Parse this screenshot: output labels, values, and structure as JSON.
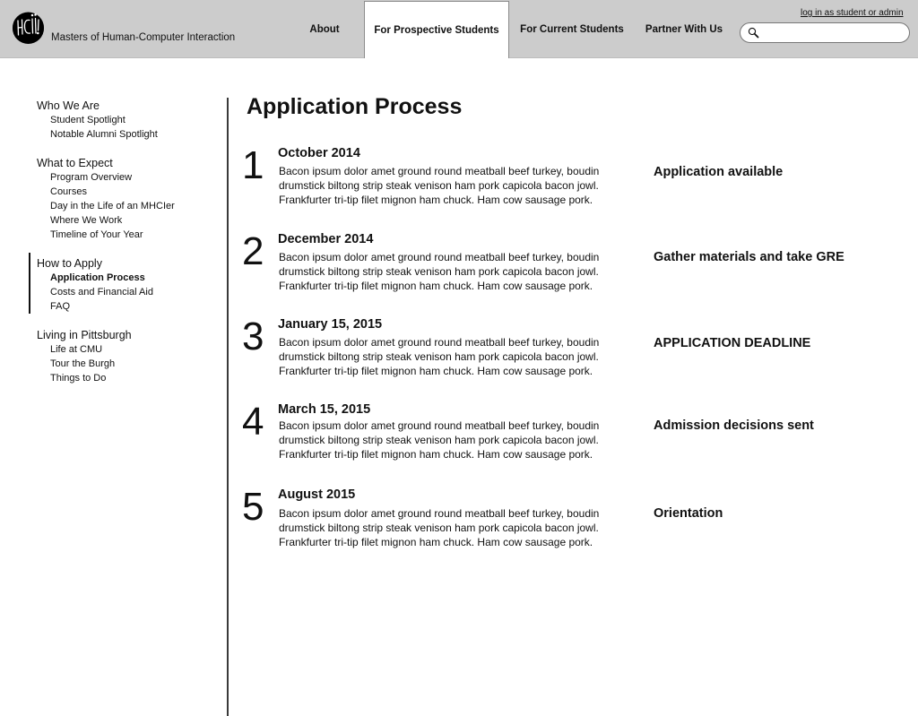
{
  "header": {
    "site_title": "Masters of Human-Computer Interaction",
    "logo_text": "HCII",
    "login_link": "log in as student or admin",
    "search": {
      "value": "",
      "placeholder": ""
    },
    "nav": [
      {
        "label": "About",
        "active": false
      },
      {
        "label": "For Prospective Students",
        "active": true
      },
      {
        "label": "For Current Students",
        "active": false
      },
      {
        "label": "Partner With Us",
        "active": false
      }
    ]
  },
  "sidebar": {
    "groups": [
      {
        "heading": "Who We Are",
        "links": [
          "Student Spotlight",
          "Notable Alumni Spotlight"
        ]
      },
      {
        "heading": "What to Expect",
        "links": [
          "Program Overview",
          "Courses",
          "Day in the Life of an MHCIer",
          "Where We Work",
          "Timeline of Your Year"
        ]
      },
      {
        "heading": "How to Apply",
        "links": [
          "Application Process",
          "Costs and Financial Aid",
          "FAQ"
        ],
        "active_link": "Application Process"
      },
      {
        "heading": "Living in Pittsburgh",
        "links": [
          "Life at CMU",
          "Tour the Burgh",
          "Things to Do"
        ]
      }
    ]
  },
  "main": {
    "title": "Application Process",
    "steps": [
      {
        "number": "1",
        "date": "October 2014",
        "description": "Bacon ipsum dolor amet ground round meatball beef turkey, boudin drumstick biltong strip steak venison ham pork capicola bacon jowl. Frankfurter tri-tip filet mignon ham chuck. Ham cow sausage pork.",
        "milestone": "Application available"
      },
      {
        "number": "2",
        "date": "December 2014",
        "description": "Bacon ipsum dolor amet ground round meatball beef turkey, boudin drumstick biltong strip steak venison ham pork capicola bacon jowl. Frankfurter tri-tip filet mignon ham chuck. Ham cow sausage pork.",
        "milestone": "Gather materials and take GRE"
      },
      {
        "number": "3",
        "date": "January 15, 2015",
        "description": "Bacon ipsum dolor amet ground round meatball beef turkey, boudin drumstick biltong strip steak venison ham pork capicola bacon jowl. Frankfurter tri-tip filet mignon ham chuck. Ham cow sausage pork.",
        "milestone": "APPLICATION DEADLINE"
      },
      {
        "number": "4",
        "date": "March 15, 2015",
        "description": "Bacon ipsum dolor amet ground round meatball beef turkey, boudin drumstick biltong strip steak venison ham pork capicola bacon jowl. Frankfurter tri-tip filet mignon ham chuck. Ham cow sausage pork.",
        "milestone": "Admission decisions sent"
      },
      {
        "number": "5",
        "date": "August 2015",
        "description": "Bacon ipsum dolor amet ground round meatball beef turkey, boudin drumstick biltong strip steak venison ham pork capicola bacon jowl. Frankfurter tri-tip filet mignon ham chuck. Ham cow sausage pork.",
        "milestone": "Orientation"
      }
    ]
  },
  "colors": {
    "header_bg": "#cccccc",
    "active_tab_bg": "#ffffff",
    "text": "#111111"
  }
}
